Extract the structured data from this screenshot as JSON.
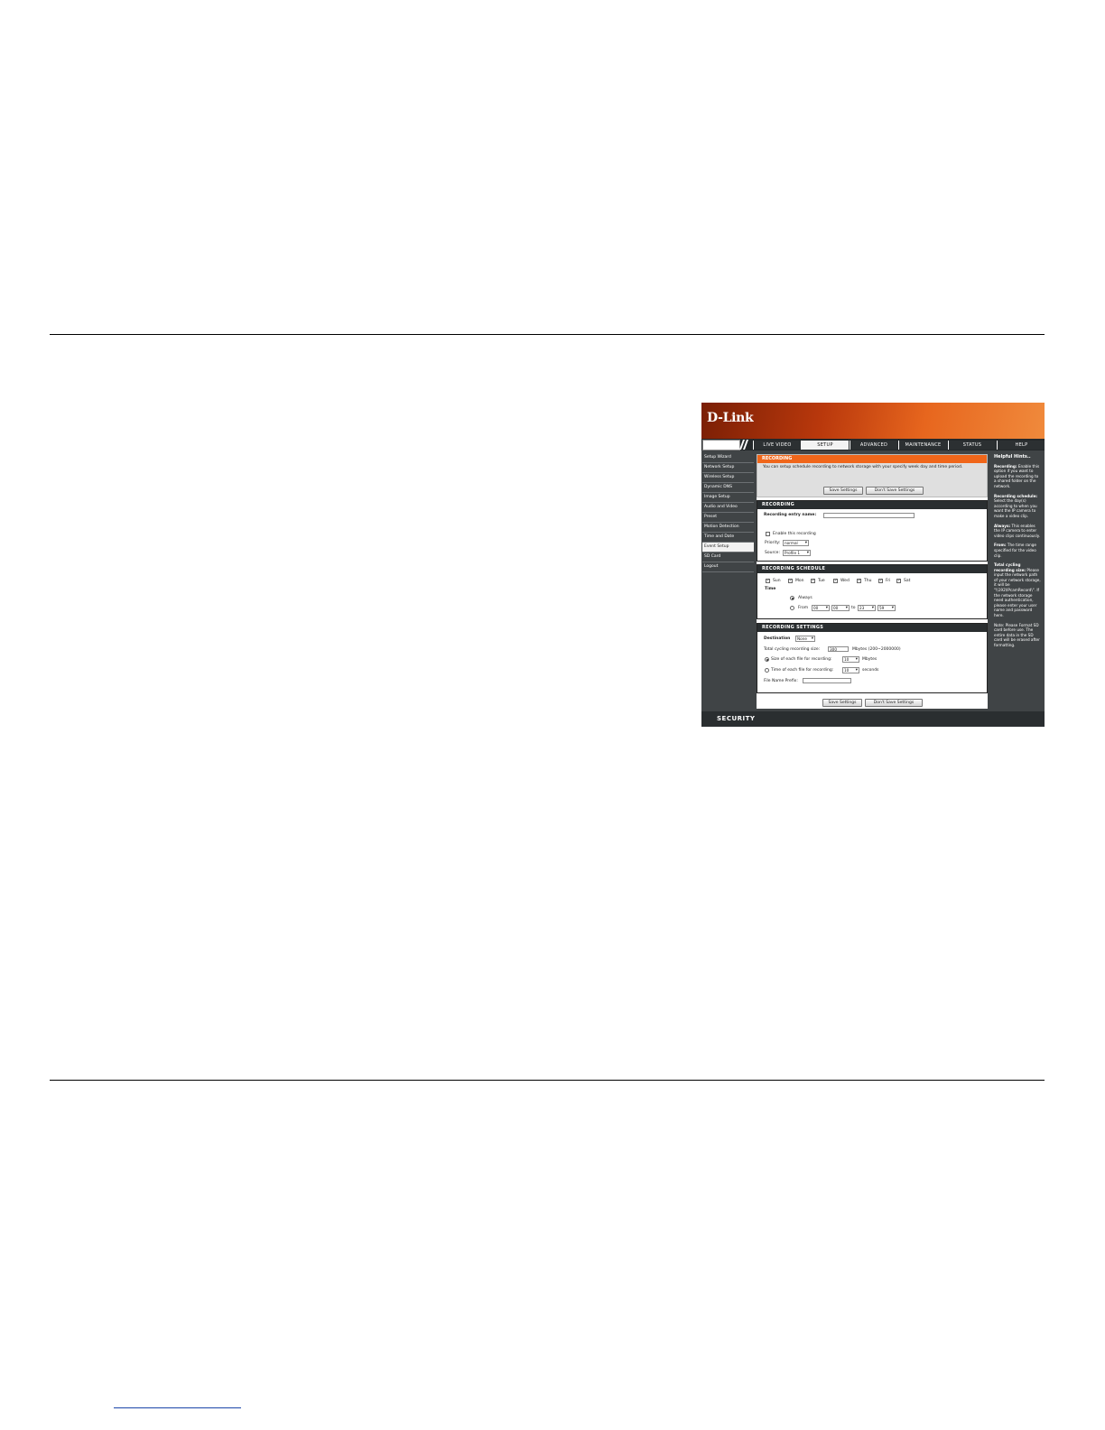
{
  "ui": {
    "logo": "D-Link",
    "tabs": [
      "LIVE VIDEO",
      "SETUP",
      "ADVANCED",
      "MAINTENANCE",
      "STATUS",
      "HELP"
    ],
    "sidebar": [
      "Setup Wizard",
      "Network Setup",
      "Wireless Setup",
      "Dynamic DNS",
      "Image Setup",
      "Audio and Video",
      "Preset",
      "Motion Detection",
      "Time and Date",
      "Event Setup",
      "SD Card",
      "Logout"
    ],
    "intro": {
      "title": "RECORDING",
      "text": "You can setup schedule recording to network storage with your specify week day and time period.",
      "save": "Save Settings",
      "dont_save": "Don't Save Settings"
    },
    "recording": {
      "title": "RECORDING",
      "entry_label": "Recording entry name:",
      "enable_label": "Enable this recording",
      "priority_label": "Priority:",
      "priority_value": "normal",
      "source_label": "Source:",
      "source_value": "Profile 1"
    },
    "schedule": {
      "title": "RECORDING SCHEDULE",
      "days": [
        "Sun",
        "Mon",
        "Tue",
        "Wed",
        "Thu",
        "Fri",
        "Sat"
      ],
      "time_label": "Time",
      "always_label": "Always",
      "from_label": "From",
      "from_h": "00",
      "from_m": "00",
      "to_label": "to",
      "to_h": "23",
      "to_m": "59"
    },
    "settings": {
      "title": "RECORDING SETTINGS",
      "dest_label": "Destination",
      "dest_value": "None",
      "total_label": "Total cycling recording size:",
      "total_value": "300",
      "total_unit": "Mbytes (200~2000000)",
      "size_label": "Size of each file for recording:",
      "size_value": "10",
      "size_unit": "Mbytes",
      "time_label": "Time of each file for recording:",
      "time_value": "10",
      "time_unit": "seconds",
      "prefix_label": "File Name Prefix:"
    },
    "bottom_save": "Save Settings",
    "bottom_dont_save": "Don't Save Settings",
    "hints": {
      "title": "Helpful Hints..",
      "items": [
        {
          "b": "Recording:",
          "t": " Enable this option if you want to upload the recording to a shared folder on the network."
        },
        {
          "b": "Recording schedule:",
          "t": " Select the day(s) according to when you want the IP camera to make a video clip."
        },
        {
          "b": "Always:",
          "t": " This enables the IP camera to enter video clips continuously."
        },
        {
          "b": "From:",
          "t": " The time range specified for the video clip."
        },
        {
          "b": "Total cycling recording size:",
          "t": " Please input the network path of your network storage, it will be \"\\\\192\\IPcamRecord\\\". If the network storage need authentication, please enter your user name and password here."
        },
        {
          "b": "",
          "t": "Note: Please Format SD card before use. The entire data in the SD card will be erased after formatting."
        }
      ]
    },
    "footer_brand": "SECURITY"
  }
}
